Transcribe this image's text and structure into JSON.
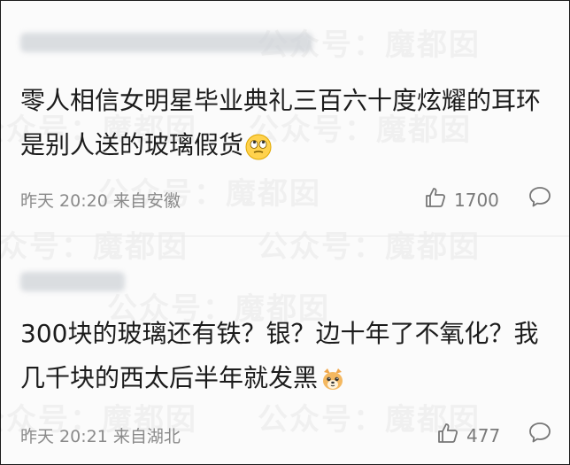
{
  "watermark": {
    "text_full": "公众号：魔都囡",
    "text_short": "公众号"
  },
  "comments": [
    {
      "content_text": "零人相信女明星毕业典礼三百六十度炫耀的耳环是别人送的玻璃假货",
      "emoji": "eye-roll-emoji",
      "timestamp": "昨天 20:20",
      "source": "来自安徽",
      "like_count": "1700"
    },
    {
      "content_text": "300块的玻璃还有铁？银？边十年了不氧化？我几千块的西太后半年就发黑",
      "emoji": "dog-emoji",
      "timestamp": "昨天 20:21",
      "source": "来自湖北",
      "like_count": "477"
    }
  ],
  "colors": {
    "text": "#1c1c1c",
    "meta": "#8a8a8a",
    "background": "#fbfbfb",
    "border": "#1a1a1a"
  }
}
